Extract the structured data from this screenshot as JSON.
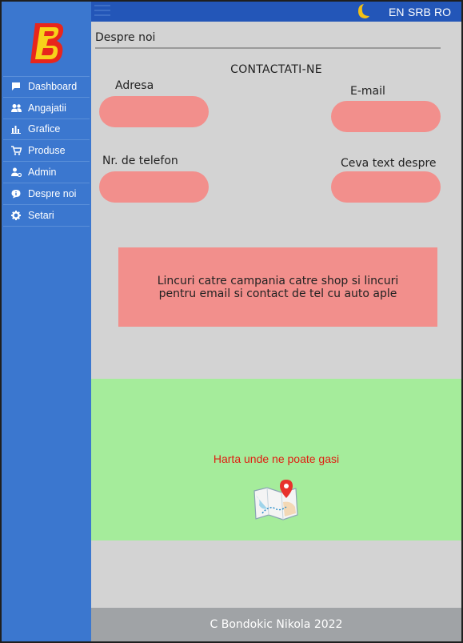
{
  "sidebar": {
    "logo_letter": "B",
    "items": [
      {
        "label": "Dashboard",
        "icon": "chat-bubble-icon"
      },
      {
        "label": "Angajatii",
        "icon": "users-icon"
      },
      {
        "label": "Grafice",
        "icon": "bar-chart-icon"
      },
      {
        "label": "Produse",
        "icon": "cart-icon"
      },
      {
        "label": "Admin",
        "icon": "user-gear-icon"
      },
      {
        "label": "Despre noi",
        "icon": "info-bubble-icon"
      },
      {
        "label": "Setari",
        "icon": "gear-icon"
      }
    ]
  },
  "topbar": {
    "languages": [
      "EN",
      "SRB",
      "RO"
    ]
  },
  "page": {
    "title": "Despre noi",
    "section_title": "CONTACTATI-NE"
  },
  "form": {
    "address_label": "Adresa",
    "email_label": "E-mail",
    "phone_label": "Nr. de telefon",
    "text_label": "Ceva text despre"
  },
  "links_box": {
    "text": "Lincuri catre campania catre shop si lincuri pentru email si contact de tel cu auto aple"
  },
  "map": {
    "text": "Harta unde ne poate gasi"
  },
  "footer": {
    "text": "C Bondokic Nikola 2022"
  },
  "colors": {
    "sidebar": "#3b77cf",
    "topbar": "#2356b8",
    "field": "#f28f8c",
    "map_bg": "#a5ec9b",
    "map_text": "#e01e12",
    "footer": "#a0a3a6"
  }
}
